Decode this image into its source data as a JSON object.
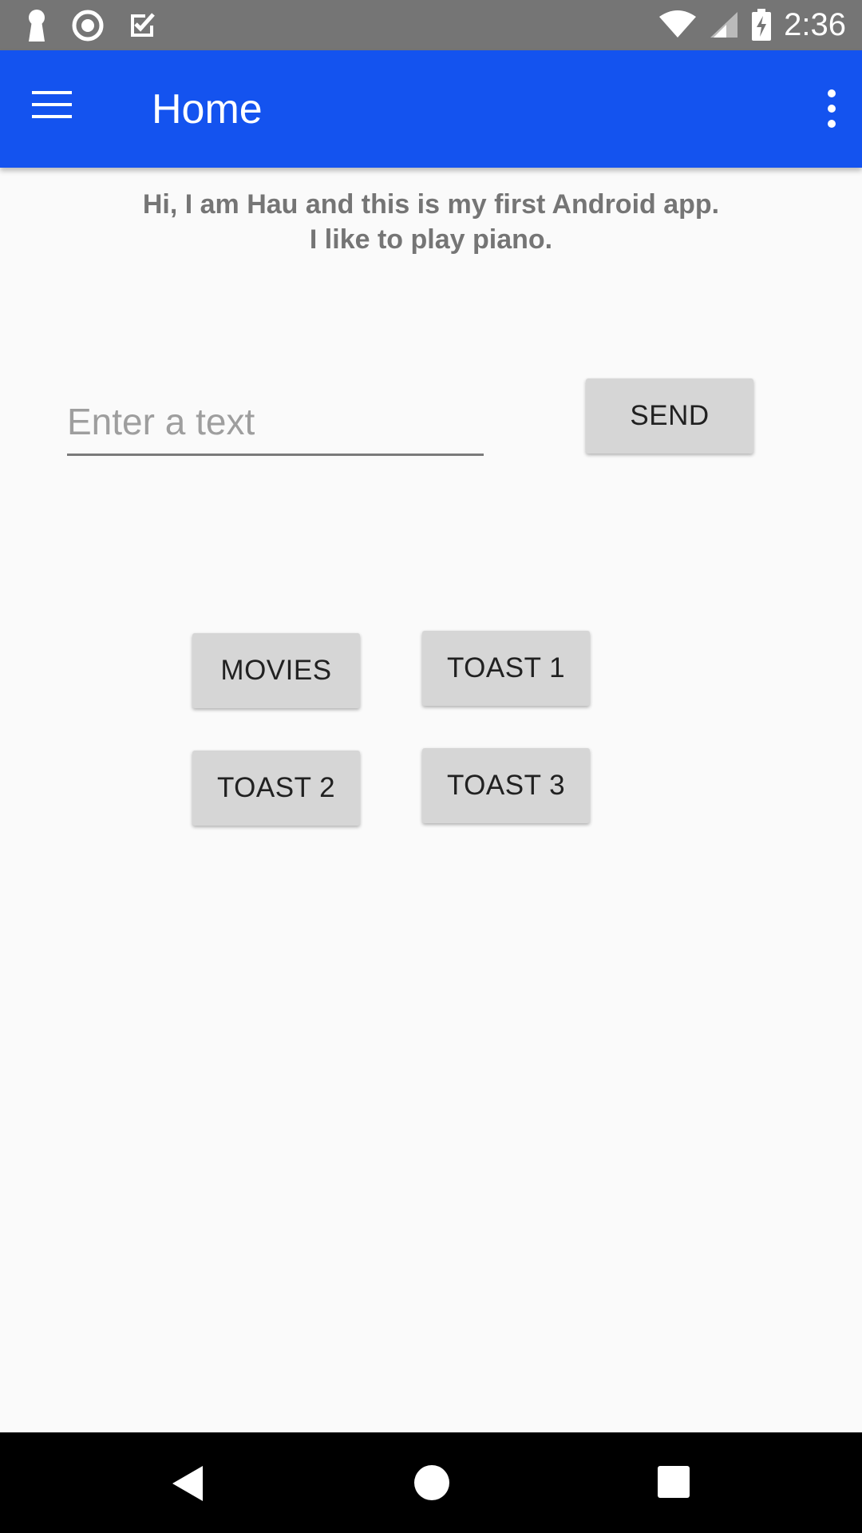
{
  "status_bar": {
    "time": "2:36",
    "icons": [
      "keyhole-icon",
      "record-icon",
      "checkbox-icon",
      "wifi-icon",
      "signal-icon",
      "battery-charging-icon"
    ]
  },
  "app_bar": {
    "title": "Home",
    "color": "#1453ef",
    "icons": [
      "hamburger-menu-icon",
      "overflow-menu-icon"
    ]
  },
  "intro": {
    "line1": "Hi, I am Hau and this is my first Android app.",
    "line2": "I like to play piano."
  },
  "input": {
    "placeholder": "Enter a text",
    "value": ""
  },
  "buttons": {
    "send": "SEND",
    "movies": "MOVIES",
    "toast1": "TOAST 1",
    "toast2": "TOAST 2",
    "toast3": "TOAST 3"
  },
  "nav_bar": {
    "icons": [
      "back-icon",
      "home-icon",
      "recents-icon"
    ]
  }
}
